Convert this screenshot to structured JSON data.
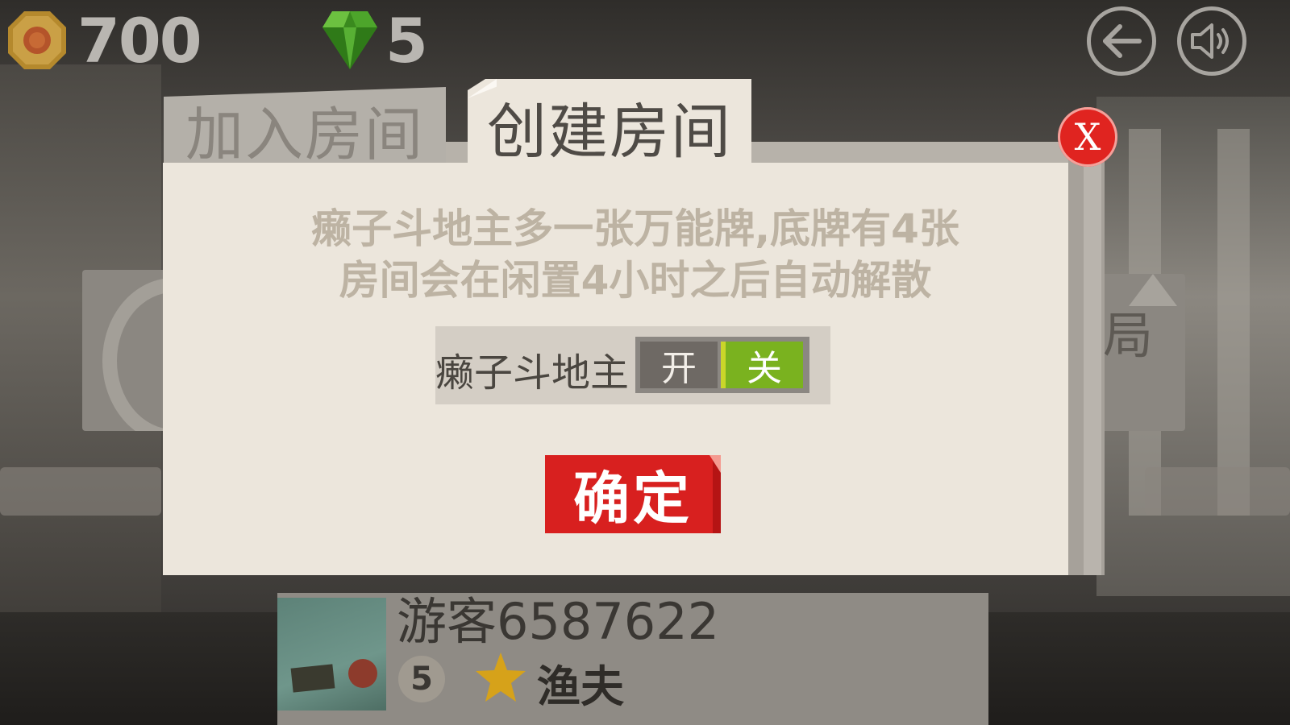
{
  "hud": {
    "coins": "700",
    "gems": "5"
  },
  "tabs": {
    "join": "加入房间",
    "create": "创建房间"
  },
  "dialog": {
    "close_label": "X",
    "desc_line1": "癞子斗地主多一张万能牌,底牌有4张",
    "desc_line2": "房间会在闲置4小时之后自动解散",
    "laizi_label": "癞子斗地主",
    "toggle_on": "开",
    "toggle_off": "关",
    "toggle_selected": "关",
    "confirm": "确定"
  },
  "background": {
    "right_glyph": "局"
  },
  "player": {
    "name": "游客6587622",
    "level": "5",
    "title": "渔夫"
  },
  "colors": {
    "accent_red": "#d8201f",
    "toggle_green": "#7ab21f",
    "panel": "#ece6dc"
  }
}
